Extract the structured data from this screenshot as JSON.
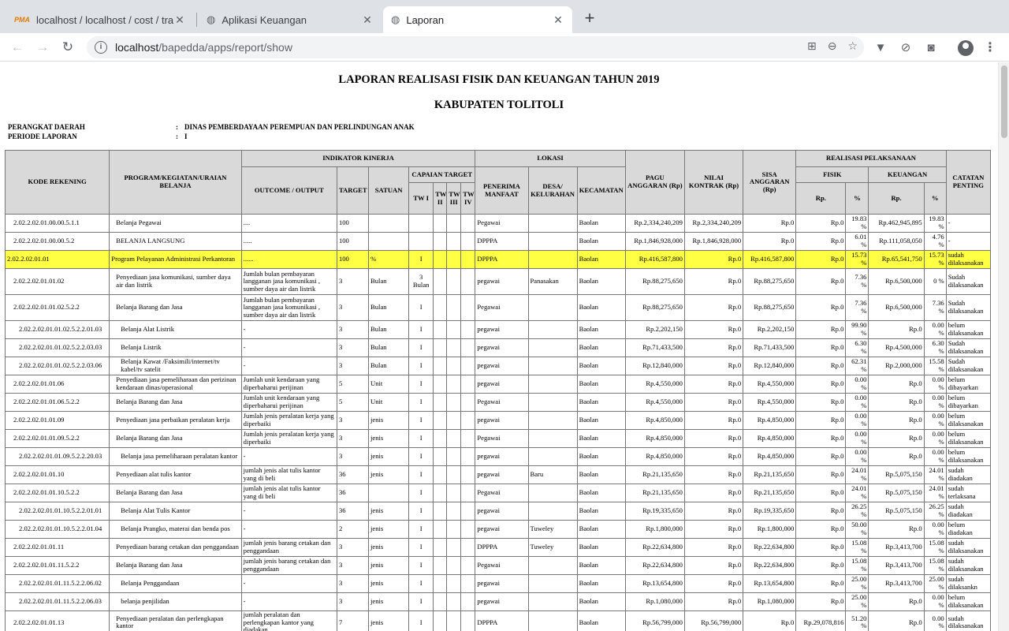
{
  "browser": {
    "tabs": [
      {
        "title": "localhost / localhost / cost / tra",
        "state": "inactive"
      },
      {
        "title": "Aplikasi Keuangan",
        "state": "inactive"
      },
      {
        "title": "Laporan",
        "state": "active"
      }
    ],
    "url_host": "localhost",
    "url_path": "/bapedda/apps/report/show"
  },
  "report": {
    "title1": "LAPORAN REALISASI FISIK DAN KEUANGAN TAHUN 2019",
    "title2": "KABUPATEN TOLITOLI",
    "perangkat_label": "PERANGKAT DAERAH",
    "perangkat_value": "DINAS PEMBERDAYAAN PEREMPUAN DAN PERLINDUNGAN ANAK",
    "periode_label": "PERIODE LAPORAN",
    "periode_value": "I",
    "colon": ":",
    "headers": {
      "kode": "KODE REKENING",
      "program": "PROGRAM/KEGIATAN/URAIAN BELANJA",
      "indikator": "INDIKATOR KINERJA",
      "lokasi": "LOKASI",
      "pagu": "PAGU ANGGARAN (Rp)",
      "nilai": "NILAI KONTRAK (Rp)",
      "sisa": "SISA ANGGARAN (Rp)",
      "realisasi": "REALISASI PELAKSANAAN",
      "catatan": "CATATAN PENTING",
      "capaian": "CAPAIAN TARGET",
      "fisik": "FISIK",
      "keuangan": "KEUANGAN",
      "outcome": "OUTCOME / OUTPUT",
      "target": "TARGET",
      "satuan": "SATUAN",
      "tw1": "TW I",
      "tw2": "TW II",
      "tw3": "TW III",
      "tw4": "TW IV",
      "penerima": "PENERIMA MANFAAT",
      "desa": "DESA/ KELURAHAN",
      "kecamatan": "KECAMATAN",
      "rp1": "Rp.",
      "pct1": "%",
      "rp2": "Rp.",
      "pct2": "%"
    },
    "rows": [
      {
        "kode": "2.02.2.02.01.00.00.5.1.1",
        "program": "Belanja Pegawai",
        "outcome": "....",
        "target": "100",
        "satuan": "",
        "tw1": "",
        "penerima": "Pegawai",
        "desa": "",
        "kec": "Baolan",
        "pagu": "Rp.2,334,240,209",
        "nilai": "Rp.2,334,240,209",
        "sisa": "Rp.0",
        "frp": "Rp.0",
        "fpct": "19.83 %",
        "krp": "Rp.462,945,895",
        "kpct": "19.83 %",
        "cat": "-",
        "indent": 1,
        "hl": false
      },
      {
        "kode": "2.02.2.02.01.00.00.5.2",
        "program": "BELANJA LANGSUNG",
        "outcome": ".....",
        "target": "100",
        "satuan": "",
        "tw1": "",
        "penerima": "DPPPA",
        "desa": "",
        "kec": "Baolan",
        "pagu": "Rp.1,846,928,000",
        "nilai": "Rp.1,846,928,000",
        "sisa": "Rp.0",
        "frp": "Rp.0",
        "fpct": "6.01 %",
        "krp": "Rp.111,058,050",
        "kpct": "4.76 %",
        "cat": "-",
        "indent": 1,
        "hl": false
      },
      {
        "kode": "2.02.2.02.01.01",
        "program": "Program Pelayanan Administrasi Perkantoran",
        "outcome": "......",
        "target": "100",
        "satuan": "%",
        "tw1": "I",
        "penerima": "DPPPA",
        "desa": "",
        "kec": "Baolan",
        "pagu": "Rp.416,587,800",
        "nilai": "Rp.0",
        "sisa": "Rp.416,587,800",
        "frp": "Rp.0",
        "fpct": "15.73 %",
        "krp": "Rp.65,541,750",
        "kpct": "15.73 %",
        "cat": "sudah dilaksanakan",
        "indent": 0,
        "hl": true
      },
      {
        "kode": "2.02.2.02.01.01.02",
        "program": "Penyediaan jasa komunikasi, sumber daya air dan listrik",
        "outcome": "Jumlah bulan pembayaran langganan jasa komunikasi , sumber daya air dan listrik",
        "target": "3",
        "satuan": "Bulan",
        "tw1": "3 Bulan",
        "penerima": "pegawai",
        "desa": "Panasakan",
        "kec": "Baolan",
        "pagu": "Rp.88,275,650",
        "nilai": "Rp.0",
        "sisa": "Rp.88,275,650",
        "frp": "Rp.0",
        "fpct": "7.36 %",
        "krp": "Rp.6,500,000",
        "kpct": "0 %",
        "cat": "Sudah dilaksanakan",
        "indent": 1,
        "hl": false
      },
      {
        "kode": "2.02.2.02.01.01.02.5.2.2",
        "program": "Belanja Barang dan Jasa",
        "outcome": "Jumlah bulan pembayaran langganan jasa komunikasi , sumber daya air dan listrik",
        "target": "3",
        "satuan": "Bulan",
        "tw1": "I",
        "penerima": "Pegawai",
        "desa": "",
        "kec": "Baolan",
        "pagu": "Rp.88,275,650",
        "nilai": "Rp.0",
        "sisa": "Rp.88,275,650",
        "frp": "Rp.0",
        "fpct": "7.36 %",
        "krp": "Rp.6,500,000",
        "kpct": "7.36 %",
        "cat": "Sudah dilaksanakan",
        "indent": 1,
        "hl": false
      },
      {
        "kode": "2.02.2.02.01.01.02.5.2.2.01.03",
        "program": "Belanja Alat Listrik",
        "outcome": "-",
        "target": "3",
        "satuan": "Bulan",
        "tw1": "I",
        "penerima": "pegawai",
        "desa": "",
        "kec": "Baolan",
        "pagu": "Rp.2,202,150",
        "nilai": "Rp.0",
        "sisa": "Rp.2,202,150",
        "frp": "Rp.0",
        "fpct": "99.90 %",
        "krp": "Rp.0",
        "kpct": "0.00 %",
        "cat": "belum dilaksanakan",
        "indent": 2,
        "hl": false
      },
      {
        "kode": "2.02.2.02.01.01.02.5.2.2.03.03",
        "program": "Belanja Listrik",
        "outcome": "-",
        "target": "3",
        "satuan": "Bulan",
        "tw1": "I",
        "penerima": "pegawai",
        "desa": "",
        "kec": "Baolan",
        "pagu": "Rp.71,433,500",
        "nilai": "Rp.0",
        "sisa": "Rp.71,433,500",
        "frp": "Rp.0",
        "fpct": "6.30 %",
        "krp": "Rp.4,500,000",
        "kpct": "6.30 %",
        "cat": "Sudah dilaksanakan",
        "indent": 2,
        "hl": false
      },
      {
        "kode": "2.02.2.02.01.01.02.5.2.2.03.06",
        "program": "Belanja Kawat /Faksimili/internet/tv kabel/tv satelit",
        "outcome": "-",
        "target": "3",
        "satuan": "Bulan",
        "tw1": "I",
        "penerima": "pegawai",
        "desa": "",
        "kec": "Baolan",
        "pagu": "Rp.12,840,000",
        "nilai": "Rp.0",
        "sisa": "Rp.12,840,000",
        "frp": "Rp.0",
        "fpct": "62.31 %",
        "krp": "Rp.2,000,000",
        "kpct": "15.58 %",
        "cat": "Sudah dilaksanakan",
        "indent": 2,
        "hl": false
      },
      {
        "kode": "2.02.2.02.01.01.06",
        "program": "Penyediaan jasa pemeliharaan dan perizinan kendaraan dinas/operasional",
        "outcome": "Jumlah unit kendaraan yang diperbaharui perijinan",
        "target": "5",
        "satuan": "Unit",
        "tw1": "I",
        "penerima": "pegawai",
        "desa": "",
        "kec": "Baolan",
        "pagu": "Rp.4,550,000",
        "nilai": "Rp.0",
        "sisa": "Rp.4,550,000",
        "frp": "Rp.0",
        "fpct": "0.00 %",
        "krp": "Rp.0",
        "kpct": "0.00 %",
        "cat": "belum dibayarkan",
        "indent": 1,
        "hl": false
      },
      {
        "kode": "2.02.2.02.01.01.06.5.2.2",
        "program": "Belanja Barang dan Jasa",
        "outcome": "Jumlah unit kendaraan yang diperbaharui perijinan",
        "target": "5",
        "satuan": "Unit",
        "tw1": "I",
        "penerima": "Pegawai",
        "desa": "",
        "kec": "Baolan",
        "pagu": "Rp.4,550,000",
        "nilai": "Rp.0",
        "sisa": "Rp.4,550,000",
        "frp": "Rp.0",
        "fpct": "0.00 %",
        "krp": "Rp.0",
        "kpct": "0.00 %",
        "cat": "belum dibayarkan",
        "indent": 1,
        "hl": false
      },
      {
        "kode": "2.02.2.02.01.01.09",
        "program": "Penyediaan jasa perbaikan peralatan kerja",
        "outcome": "Jumlah jenis peralatan kerja yang diperbaiki",
        "target": "3",
        "satuan": "jenis",
        "tw1": "I",
        "penerima": "pegawai",
        "desa": "",
        "kec": "Baolan",
        "pagu": "Rp.4,850,000",
        "nilai": "Rp.0",
        "sisa": "Rp.4,850,000",
        "frp": "Rp.0",
        "fpct": "0.00 %",
        "krp": "Rp.0",
        "kpct": "0.00 %",
        "cat": "belum dilaksanakan",
        "indent": 1,
        "hl": false
      },
      {
        "kode": "2.02.2.02.01.01.09.5.2.2",
        "program": "Belanja Barang dan Jasa",
        "outcome": "Jumlah jenis peralatan kerja yang diperbaiki",
        "target": "3",
        "satuan": "jenis",
        "tw1": "I",
        "penerima": "Pegawai",
        "desa": "",
        "kec": "Baolan",
        "pagu": "Rp.4,850,000",
        "nilai": "Rp.0",
        "sisa": "Rp.4,850,000",
        "frp": "Rp.0",
        "fpct": "0.00 %",
        "krp": "Rp.0",
        "kpct": "0.00 %",
        "cat": "belum dilaksanakan",
        "indent": 1,
        "hl": false
      },
      {
        "kode": "2.02.2.02.01.01.09.5.2.2.20.03",
        "program": "Belanja jasa pemeliharaan peralatan kantor",
        "outcome": "-",
        "target": "3",
        "satuan": "jenis",
        "tw1": "I",
        "penerima": "pegawai",
        "desa": "",
        "kec": "Baolan",
        "pagu": "Rp.4,850,000",
        "nilai": "Rp.0",
        "sisa": "Rp.4,850,000",
        "frp": "Rp.0",
        "fpct": "0.00 %",
        "krp": "Rp.0",
        "kpct": "0.00 %",
        "cat": "belum dilaksanakan",
        "indent": 2,
        "hl": false
      },
      {
        "kode": "2.02.2.02.01.01.10",
        "program": "Penyediaan alat tulis kantor",
        "outcome": "jumlah jenis alat tulis kantor yang di beli",
        "target": "36",
        "satuan": "jenis",
        "tw1": "I",
        "penerima": "pegawai",
        "desa": "Baru",
        "kec": "Baolan",
        "pagu": "Rp.21,135,650",
        "nilai": "Rp.0",
        "sisa": "Rp.21,135,650",
        "frp": "Rp.0",
        "fpct": "24.01 %",
        "krp": "Rp.5,075,150",
        "kpct": "24.01 %",
        "cat": "sudah diadakan",
        "indent": 1,
        "hl": false
      },
      {
        "kode": "2.02.2.02.01.01.10.5.2.2",
        "program": "Belanja Barang dan Jasa",
        "outcome": "jumlah jenis alat tulis kantor yang di beli",
        "target": "36",
        "satuan": "",
        "tw1": "I",
        "penerima": "Pegawai",
        "desa": "",
        "kec": "Baolan",
        "pagu": "Rp.21,135,650",
        "nilai": "Rp.0",
        "sisa": "Rp.21,135,650",
        "frp": "Rp.0",
        "fpct": "24.01 %",
        "krp": "Rp.5,075,150",
        "kpct": "24.01 %",
        "cat": "sudah terlaksana",
        "indent": 1,
        "hl": false
      },
      {
        "kode": "2.02.2.02.01.01.10.5.2.2.01.01",
        "program": "Belanja Alat Tulis Kantor",
        "outcome": "-",
        "target": "36",
        "satuan": "jenis",
        "tw1": "I",
        "penerima": "pegawai",
        "desa": "",
        "kec": "Baolan",
        "pagu": "Rp.19,335,650",
        "nilai": "Rp.0",
        "sisa": "Rp.19,335,650",
        "frp": "Rp.0",
        "fpct": "26.25 %",
        "krp": "Rp.5,075,150",
        "kpct": "26.25 %",
        "cat": "sudah diadakan",
        "indent": 2,
        "hl": false
      },
      {
        "kode": "2.02.2.02.01.01.10.5.2.2.01.04",
        "program": "Belanja Prangko, materai dan benda pos",
        "outcome": "-",
        "target": "2",
        "satuan": "jenis",
        "tw1": "I",
        "penerima": "pegawai",
        "desa": "Tuweley",
        "kec": "Baolan",
        "pagu": "Rp.1,800,000",
        "nilai": "Rp.0",
        "sisa": "Rp.1,800,000",
        "frp": "Rp.0",
        "fpct": "50.00 %",
        "krp": "Rp.0",
        "kpct": "0.00 %",
        "cat": "belum diadakan",
        "indent": 2,
        "hl": false
      },
      {
        "kode": "2.02.2.02.01.01.11",
        "program": "Penyediaan barang cetakan dan penggandaan",
        "outcome": "jumlah jenis barang cetakan dan penggandaan",
        "target": "3",
        "satuan": "jenis",
        "tw1": "I",
        "penerima": "DPPPA",
        "desa": "Tuweley",
        "kec": "Baolan",
        "pagu": "Rp.22,634,800",
        "nilai": "Rp.0",
        "sisa": "Rp.22,634,800",
        "frp": "Rp.0",
        "fpct": "15.08 %",
        "krp": "Rp.3,413,700",
        "kpct": "15.08 %",
        "cat": "sudah dilaksanakan",
        "indent": 1,
        "hl": false
      },
      {
        "kode": "2.02.2.02.01.01.11.5.2.2",
        "program": "Belanja Barang dan Jasa",
        "outcome": "jumlah jenis barang cetakan dan penggandaan",
        "target": "3",
        "satuan": "jenis",
        "tw1": "I",
        "penerima": "Pegawai",
        "desa": "",
        "kec": "Baolan",
        "pagu": "Rp.22,634,800",
        "nilai": "Rp.0",
        "sisa": "Rp.22,634,800",
        "frp": "Rp.0",
        "fpct": "15.08 %",
        "krp": "Rp.3,413,700",
        "kpct": "15.08 %",
        "cat": "sudah dilaksanakan",
        "indent": 1,
        "hl": false
      },
      {
        "kode": "2.02.2.02.01.01.11.5.2.2.06.02",
        "program": "Belanja Penggandaan",
        "outcome": "-",
        "target": "3",
        "satuan": "jenis",
        "tw1": "I",
        "penerima": "pegawai",
        "desa": "",
        "kec": "Baolan",
        "pagu": "Rp.13,654,800",
        "nilai": "Rp.0",
        "sisa": "Rp.13,654,800",
        "frp": "Rp.0",
        "fpct": "25.00 %",
        "krp": "Rp.3,413,700",
        "kpct": "25.00 %",
        "cat": "sudah dilaksankn",
        "indent": 2,
        "hl": false
      },
      {
        "kode": "2.02.2.02.01.01.11.5.2.2.06.03",
        "program": "belanja penjilidan",
        "outcome": "-",
        "target": "3",
        "satuan": "jenis",
        "tw1": "I",
        "penerima": "pegawai",
        "desa": "",
        "kec": "Baolan",
        "pagu": "Rp.1,080,000",
        "nilai": "Rp.0",
        "sisa": "Rp.1,080,000",
        "frp": "Rp.0",
        "fpct": "25.00 %",
        "krp": "Rp.0",
        "kpct": "0.00 %",
        "cat": "belum dilaksanakan",
        "indent": 2,
        "hl": false
      },
      {
        "kode": "2.02.2.02.01.01.13",
        "program": "Penyediaan peralatan dan perlengkapan kantor",
        "outcome": "jumlah peralatan dan perlengkapan kantor yang diadakan",
        "target": "7",
        "satuan": "jenis",
        "tw1": "I",
        "penerima": "DPPPA",
        "desa": "",
        "kec": "Baolan",
        "pagu": "Rp.56,799,000",
        "nilai": "Rp.56,799,000",
        "sisa": "Rp.0",
        "frp": "Rp.29,078,816",
        "fpct": "51.20 %",
        "krp": "Rp.0",
        "kpct": "0.00 %",
        "cat": "sudah dilaksanakan",
        "indent": 1,
        "hl": false
      }
    ]
  }
}
